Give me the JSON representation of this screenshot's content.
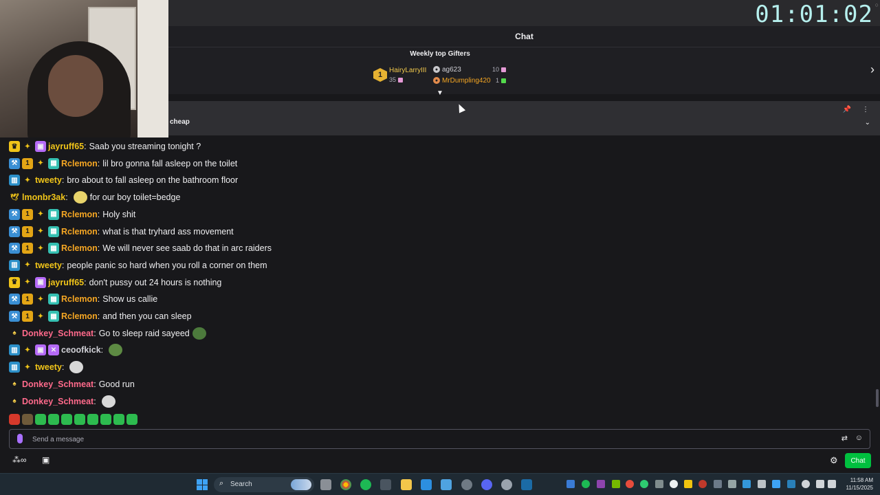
{
  "timer": "01:01:02",
  "chat_header": {
    "title": "Chat"
  },
  "gifters": {
    "title": "Weekly top Gifters",
    "first": {
      "rank": "1",
      "name": "HairyLarryIII",
      "count": "35"
    },
    "second": {
      "name": "ag623",
      "count": "10"
    },
    "third": {
      "name": "MrDumpling420",
      "count": "1"
    }
  },
  "pinned": {
    "text": "cheap"
  },
  "messages": [
    {
      "user": "jayruff65",
      "color": "#f0c419",
      "text": "Saab you streaming tonight ?",
      "badges": [
        "crown-badge",
        "bird-badge",
        "sub-badge"
      ]
    },
    {
      "user": "Rclemon",
      "color": "#f5a623",
      "text": "lil bro gonna fall asleep on the toilet",
      "badges": [
        "hammer-badge",
        "vip-badge",
        "bird-badge",
        "gift-badge"
      ]
    },
    {
      "user": "tweety",
      "color": "#f0c419",
      "text": "bro about to fall asleep on the bathroom floor",
      "badges": [
        "blue-badge",
        "bird-badge"
      ]
    },
    {
      "user": "lmonbr3ak",
      "color": "#f0c419",
      "text": "for our boy toilet=bedge",
      "badges": [
        "dove-badge"
      ],
      "emote": "#e8d36b"
    },
    {
      "user": "Rclemon",
      "color": "#f5a623",
      "text": "Holy shit",
      "badges": [
        "hammer-badge",
        "vip-badge",
        "bird-badge",
        "gift-badge"
      ]
    },
    {
      "user": "Rclemon",
      "color": "#f5a623",
      "text": "what is that tryhard ass movement",
      "badges": [
        "hammer-badge",
        "vip-badge",
        "bird-badge",
        "gift-badge"
      ]
    },
    {
      "user": "Rclemon",
      "color": "#f5a623",
      "text": "We will never see saab do that in arc raiders",
      "badges": [
        "hammer-badge",
        "vip-badge",
        "bird-badge",
        "gift-badge"
      ]
    },
    {
      "user": "tweety",
      "color": "#f0c419",
      "text": "people panic so hard when you roll a corner on them",
      "badges": [
        "blue-badge",
        "bird-badge"
      ]
    },
    {
      "user": "jayruff65",
      "color": "#f0c419",
      "text": "don't pussy out 24 hours is nothing",
      "badges": [
        "crown-badge",
        "bird-badge",
        "sub-badge"
      ]
    },
    {
      "user": "Rclemon",
      "color": "#f5a623",
      "text": "Show us callie",
      "badges": [
        "hammer-badge",
        "vip-badge",
        "bird-badge",
        "gift-badge"
      ]
    },
    {
      "user": "Rclemon",
      "color": "#f5a623",
      "text": "and then you can sleep",
      "badges": [
        "hammer-badge",
        "vip-badge",
        "bird-badge",
        "gift-badge"
      ]
    },
    {
      "user": "Donkey_Schmeat",
      "color": "#ff6a8b",
      "text": "Go to sleep raid sayeed",
      "badges": [
        "duck-badge"
      ],
      "emote": "#4c7a3c",
      "emote_after": true
    },
    {
      "user": "ceoofkick",
      "color": "#d0d0d6",
      "text": "",
      "badges": [
        "blue-badge",
        "bird-badge",
        "sub-badge",
        "kick-badge"
      ],
      "emote": "#5d8a43"
    },
    {
      "user": "tweety",
      "color": "#f0c419",
      "text": "",
      "badges": [
        "blue-badge",
        "bird-badge"
      ],
      "emote": "#d8d8d8"
    },
    {
      "user": "Donkey_Schmeat",
      "color": "#ff6a8b",
      "text": "Good run",
      "badges": [
        "duck-badge"
      ]
    },
    {
      "user": "Donkey_Schmeat",
      "color": "#ff6a8b",
      "text": "",
      "badges": [
        "duck-badge"
      ],
      "emote": "#d8d8d8"
    }
  ],
  "emote_bar": [
    "#d6392b",
    "#6e5a3a",
    "#2dbb4f",
    "#2dbb4f",
    "#2dbb4f",
    "#2dbb4f",
    "#2dbb4f",
    "#2dbb4f",
    "#2dbb4f",
    "#2dbb4f"
  ],
  "input": {
    "placeholder": "Send a message"
  },
  "chat_button": {
    "label": "Chat"
  },
  "taskbar": {
    "search_label": "Search",
    "time": "11:58 AM",
    "date": "11/15/2025"
  }
}
